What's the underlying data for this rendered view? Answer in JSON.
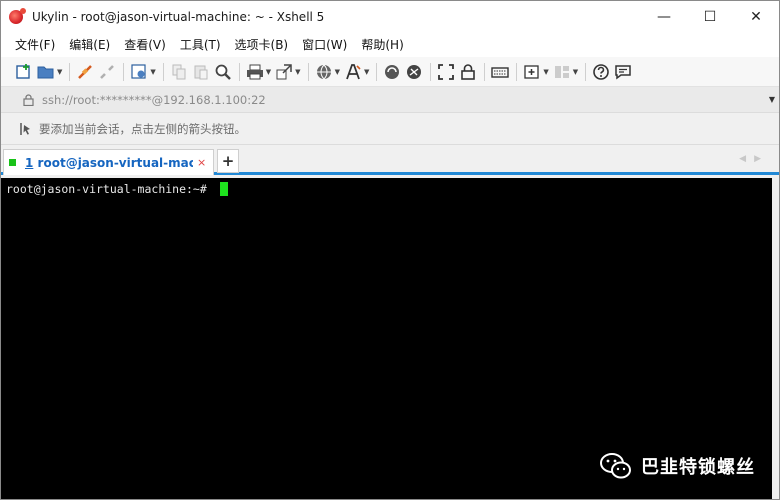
{
  "window": {
    "title": "Ukylin - root@jason-virtual-machine: ~ - Xshell 5",
    "minimize": "—",
    "maximize": "☐",
    "close": "✕"
  },
  "menu": {
    "items": [
      "文件(F)",
      "编辑(E)",
      "查看(V)",
      "工具(T)",
      "选项卡(B)",
      "窗口(W)",
      "帮助(H)"
    ]
  },
  "toolbar": {
    "icons": [
      "new-session-icon",
      "open-folder-icon",
      "connect-icon",
      "disconnect-icon",
      "session-properties-icon",
      "copy-icon",
      "paste-icon",
      "find-icon",
      "print-icon",
      "transfer-icon",
      "globe-icon",
      "font-icon",
      "xftp-icon",
      "xmanager-icon",
      "fullscreen-icon",
      "lock-icon",
      "keyboard-icon",
      "new-tab-icon",
      "layout-icon",
      "help-icon",
      "chat-icon"
    ]
  },
  "address": {
    "value": "ssh://root:*********@192.168.1.100:22"
  },
  "hint": {
    "text": "要添加当前会话，点击左侧的箭头按钮。"
  },
  "tabs": [
    {
      "index": "1",
      "label": "root@jason-virtual-machin...",
      "close": "×",
      "status_color": "#18c218"
    }
  ],
  "tab_add": "+",
  "tab_nav": "◀▶",
  "terminal": {
    "prompt": "root@jason-virtual-machine:~# ",
    "cursor_color": "#1ee31e"
  },
  "watermark": {
    "text": "巴韭特锁螺丝"
  },
  "colors": {
    "accent": "#2189d6",
    "terminal_bg": "#000000",
    "tab_text": "#1565c0"
  }
}
